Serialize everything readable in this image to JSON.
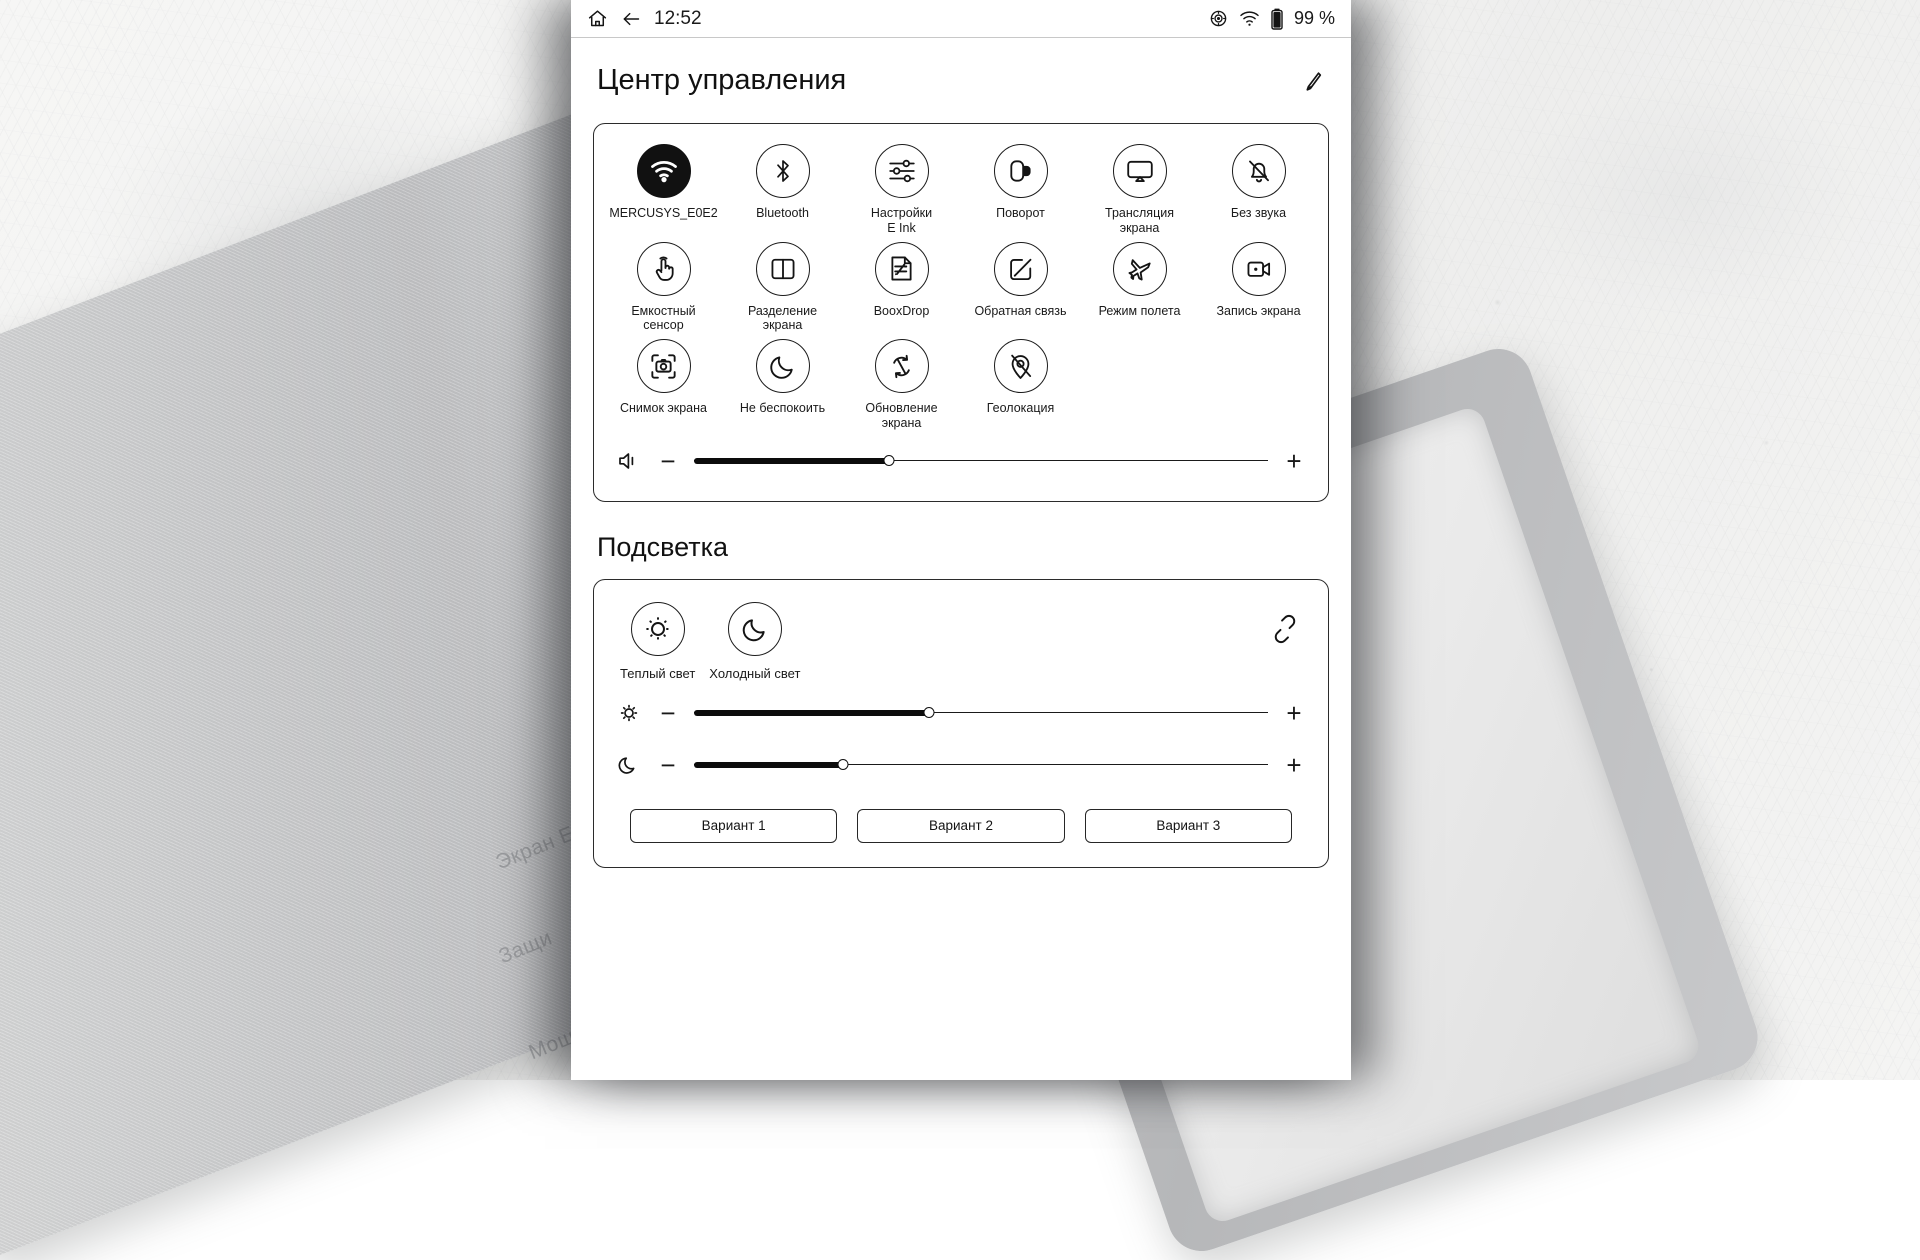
{
  "status_bar": {
    "home_icon": "home-icon",
    "back_icon": "back-arrow-icon",
    "time": "12:52",
    "refresh_mode_icon": "refresh-mode-icon",
    "wifi_icon": "wifi-icon",
    "battery_icon": "battery-icon",
    "battery_percent": "99 %"
  },
  "header": {
    "title": "Центр управления",
    "edit_icon": "pencil-edit-icon"
  },
  "toggles": [
    {
      "label": "MERCUSYS_E0E2",
      "icon": "wifi-icon",
      "active": true
    },
    {
      "label": "Bluetooth",
      "icon": "bluetooth-icon",
      "active": false
    },
    {
      "label": "Настройки\nE Ink",
      "icon": "sliders-icon",
      "active": false
    },
    {
      "label": "Поворот",
      "icon": "rotate-screen-icon",
      "active": false
    },
    {
      "label": "Трансляция\nэкрана",
      "icon": "cast-screen-icon",
      "active": false
    },
    {
      "label": "Без звука",
      "icon": "bell-muted-icon",
      "active": false
    },
    {
      "label": "Емкостный\nсенсор",
      "icon": "touch-hand-icon",
      "active": false
    },
    {
      "label": "Разделение\nэкрана",
      "icon": "split-screen-icon",
      "active": false
    },
    {
      "label": "BooxDrop",
      "icon": "booxdrop-icon",
      "active": false
    },
    {
      "label": "Обратная связь",
      "icon": "feedback-icon",
      "active": false
    },
    {
      "label": "Режим полета",
      "icon": "airplane-icon",
      "active": false
    },
    {
      "label": "Запись экрана",
      "icon": "screen-record-icon",
      "active": false
    },
    {
      "label": "Снимок экрана",
      "icon": "screenshot-icon",
      "active": false
    },
    {
      "label": "Не беспокоить",
      "icon": "moon-icon",
      "active": false
    },
    {
      "label": "Обновление\nэкрана",
      "icon": "refresh-screen-icon",
      "active": false
    },
    {
      "label": "Геолокация",
      "icon": "location-off-icon",
      "active": false
    }
  ],
  "volume": {
    "icon": "volume-icon",
    "minus_label": "−",
    "plus_label": "+",
    "value": 34
  },
  "backlight": {
    "heading": "Подсветка",
    "link_icon": "broken-link-icon",
    "modes": [
      {
        "label": "Теплый свет",
        "icon": "sun-icon"
      },
      {
        "label": "Холодный свет",
        "icon": "moon-icon"
      }
    ],
    "sliders": [
      {
        "name": "warm-light",
        "icon": "sun-small-icon",
        "minus_label": "−",
        "plus_label": "+",
        "value": 41
      },
      {
        "name": "cold-light",
        "icon": "moon-small-icon",
        "minus_label": "−",
        "plus_label": "+",
        "value": 26
      }
    ],
    "variants": [
      {
        "label": "Вариант 1"
      },
      {
        "label": "Вариант 2"
      },
      {
        "label": "Вариант 3"
      }
    ]
  },
  "background": {
    "case_texts": [
      "Экран E",
      "Защи",
      "Мощ"
    ]
  },
  "colors": {
    "ink": "#141414",
    "panel_border": "#2b2b2b",
    "screen_bg": "#ffffff",
    "active_fill": "#111111"
  }
}
